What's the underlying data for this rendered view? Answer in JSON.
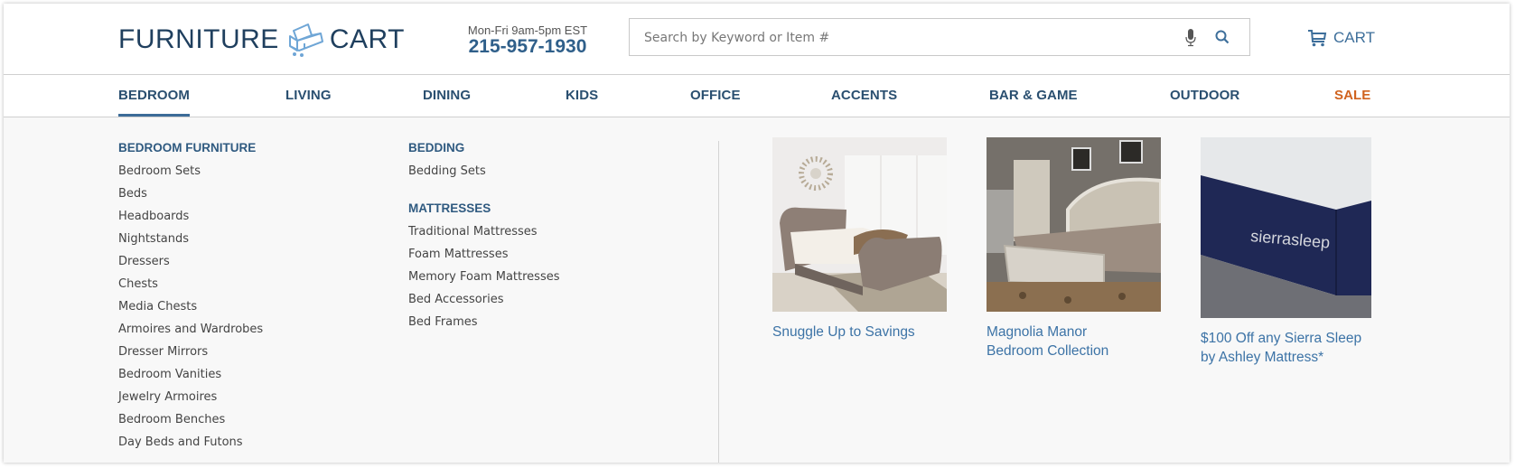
{
  "header": {
    "logo": {
      "left_text": "FURNITURE",
      "right_text": "CART",
      "icon": "chair-cart-icon"
    },
    "hours": "Mon-Fri 9am-5pm EST",
    "phone": "215-957-1930",
    "search": {
      "placeholder": "Search by Keyword or Item #",
      "value": "",
      "mic_icon": "microphone-icon",
      "search_icon": "magnifier-icon"
    },
    "cart": {
      "label": "CART",
      "icon": "shopping-cart-icon"
    }
  },
  "nav": {
    "items": [
      {
        "label": "BEDROOM",
        "active": true
      },
      {
        "label": "LIVING"
      },
      {
        "label": "DINING"
      },
      {
        "label": "KIDS"
      },
      {
        "label": "OFFICE"
      },
      {
        "label": "ACCENTS"
      },
      {
        "label": "BAR & GAME"
      },
      {
        "label": "OUTDOOR"
      },
      {
        "label": "SALE",
        "highlight": "#d0631f"
      }
    ]
  },
  "menu": {
    "columns": [
      {
        "sections": [
          {
            "heading": "BEDROOM FURNITURE",
            "links": [
              "Bedroom Sets",
              "Beds",
              "Headboards",
              "Nightstands",
              "Dressers",
              "Chests",
              "Media Chests",
              "Armoires and Wardrobes",
              "Dresser Mirrors",
              "Bedroom Vanities",
              "Jewelry Armoires",
              "Bedroom Benches",
              "Day Beds and Futons"
            ]
          }
        ]
      },
      {
        "sections": [
          {
            "heading": "BEDDING",
            "links": [
              "Bedding Sets"
            ]
          },
          {
            "heading": "MATTRESSES",
            "links": [
              "Traditional Mattresses",
              "Foam Mattresses",
              "Memory Foam Mattresses",
              "Bed Accessories",
              "Bed Frames"
            ]
          }
        ]
      }
    ],
    "promos": [
      {
        "caption_line1": "Snuggle Up to Savings",
        "caption_line2": "",
        "image": "tufted-sleigh-bed-photo"
      },
      {
        "caption_line1": "Magnolia Manor",
        "caption_line2": "Bedroom Collection",
        "image": "magnolia-manor-bed-photo"
      },
      {
        "caption_line1": "$100 Off any Sierra Sleep",
        "caption_line2": "by Ashley Mattress*",
        "image": "sierra-sleep-mattress-photo",
        "brand_text": "sierrasleep"
      }
    ]
  },
  "colors": {
    "brand_dark": "#1f3f5e",
    "link_blue": "#3c73a6",
    "sale_orange": "#d0631f",
    "nav_text": "#2a4f70"
  }
}
